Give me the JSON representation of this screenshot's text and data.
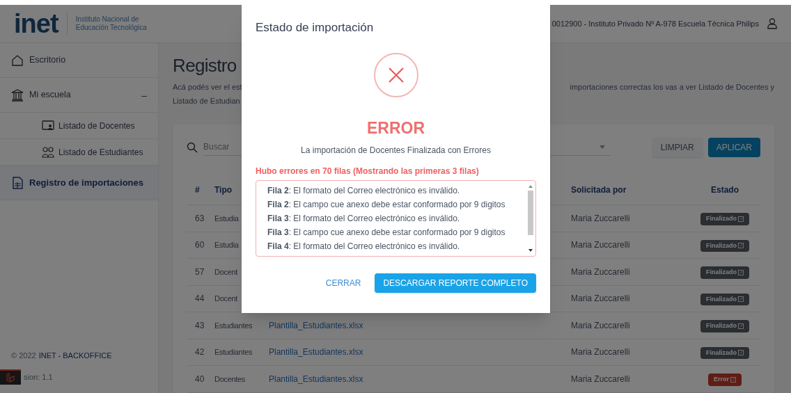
{
  "header": {
    "logo": "inet",
    "logo_subtitle": [
      "Instituto Nacional de",
      "Educación Tecnológica"
    ],
    "school": "0012900 - Instituto Privado Nº A-978 Escuela Técnica Philips"
  },
  "sidebar": {
    "items": [
      {
        "label": "Escritorio",
        "kind": "top",
        "selected": false
      },
      {
        "label": "Mi escuela",
        "kind": "group",
        "selected": false,
        "expanded": true,
        "toggle": "–",
        "children": [
          {
            "label": "Listado de Docentes",
            "kind": "teachers"
          },
          {
            "label": "Listado de Estudiantes",
            "kind": "students"
          }
        ]
      },
      {
        "label": "Registro de importaciones",
        "kind": "imports",
        "selected": true
      }
    ],
    "footer_year": "© 2022",
    "footer_brand": "INET - BACKOFFICE",
    "version": "sion: 1.1"
  },
  "page": {
    "title": "Registro",
    "description_left": [
      "Acá podés ver el est",
      "Listado de Estudian"
    ],
    "description_right": "importaciones correctas los vas a ver Listado de Docentes y"
  },
  "filters": {
    "search_placeholder": "Buscar",
    "buttons": [
      {
        "label": "LIMPIAR",
        "kind": "secondary"
      },
      {
        "label": "APLICAR",
        "kind": "primary"
      }
    ]
  },
  "table": {
    "columns": [
      "#",
      "Tipo",
      "Solicitada por",
      "Estado"
    ],
    "rows": [
      {
        "id": "63",
        "tipo": "Estudia",
        "solicitada_por": "Maria Zuccarelli",
        "estado": "Finalizado",
        "kind": "done"
      },
      {
        "id": "60",
        "tipo": "Estudia",
        "solicitada_por": "Maria Zuccarelli",
        "estado": "Finalizado",
        "kind": "done"
      },
      {
        "id": "57",
        "tipo": "Docent",
        "solicitada_por": "Maria Zuccarelli",
        "estado": "Finalizado",
        "kind": "done"
      },
      {
        "id": "44",
        "tipo": "Docent",
        "solicitada_por": "Maria Zuccarelli",
        "estado": "Finalizado",
        "kind": "done"
      },
      {
        "id": "43",
        "tipo": "Estudiantes",
        "archivo": "Plantilla_Estudiantes.xlsx",
        "solicitada_por": "Maria Zuccarelli",
        "estado": "Finalizado",
        "kind": "done"
      },
      {
        "id": "42",
        "tipo": "Estudiantes",
        "archivo": "Plantilla_Estudiantes.xlsx",
        "solicitada_por": "Maria Zuccarelli",
        "estado": "Finalizado",
        "kind": "done"
      },
      {
        "id": "40",
        "tipo": "Docentes",
        "archivo": "Plantilla_Estudiantes.xlsx",
        "solicitada_por": "Maria Zuccarelli",
        "estado": "Error",
        "kind": "error"
      }
    ]
  },
  "modal": {
    "title": "Estado de importación",
    "status": "ERROR",
    "message": "La importación de Docentes Finalizada con Errores",
    "errors_heading": "Hubo errores en 70 filas (Mostrando las primeras 3 filas)",
    "errors": [
      "**Fila 2**: El formato del Correo electrónico es inválido.",
      "**Fila 2**: El campo cue anexo debe estar conformado por 9 digitos",
      "**Fila 3**: El formato del Correo electrónico es inválido.",
      "**Fila 3**: El campo cue anexo debe estar conformado por 9 digitos",
      "**Fila 4**: El formato del Correo electrónico es inválido."
    ],
    "buttons": [
      {
        "label": "CERRAR",
        "kind": "text"
      },
      {
        "label": "DESCARGAR REPORTE COMPLETO",
        "kind": "primary"
      }
    ]
  }
}
